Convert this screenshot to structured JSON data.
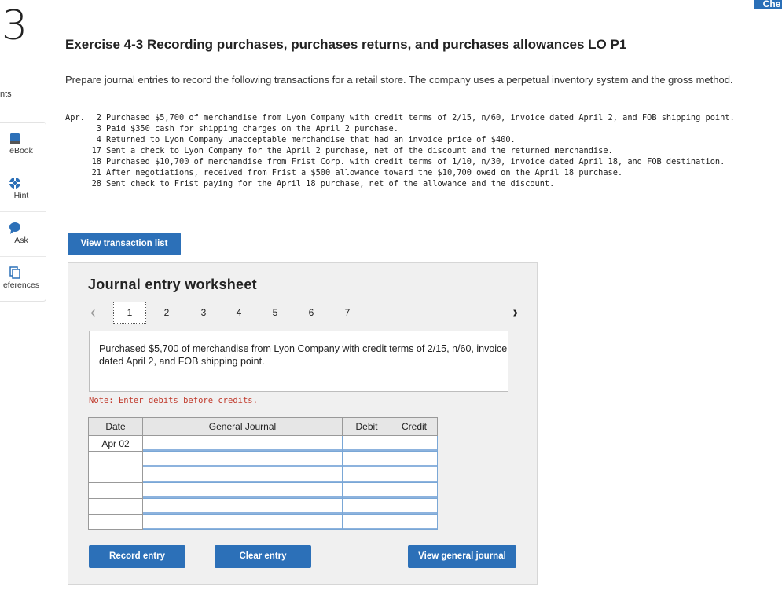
{
  "question_number": "3",
  "top_right_button": "Che",
  "cut_sidebar_label": "nts",
  "sidebar": [
    {
      "label": "eBook",
      "icon": "book-icon"
    },
    {
      "label": "Hint",
      "icon": "lifebuoy-icon"
    },
    {
      "label": "Ask",
      "icon": "speech-bubble-icon"
    },
    {
      "label": "eferences",
      "icon": "copy-icon"
    }
  ],
  "title": "Exercise 4-3 Recording purchases, purchases returns, and purchases allowances LO P1",
  "intro": "Prepare journal entries to record the following transactions for a retail store. The company uses a perpetual inventory system and the gross method.",
  "transactions": {
    "month": "Apr.",
    "items": [
      {
        "day": "2",
        "text": "Purchased $5,700 of merchandise from Lyon Company with credit terms of 2/15, n/60, invoice dated April 2, and FOB shipping point."
      },
      {
        "day": "3",
        "text": "Paid $350 cash for shipping charges on the April 2 purchase."
      },
      {
        "day": "4",
        "text": "Returned to Lyon Company unacceptable merchandise that had an invoice price of $400."
      },
      {
        "day": "17",
        "text": "Sent a check to Lyon Company for the April 2 purchase, net of the discount and the returned merchandise."
      },
      {
        "day": "18",
        "text": "Purchased $10,700 of merchandise from Frist Corp. with credit terms of 1/10, n/30, invoice dated April 18, and FOB destination."
      },
      {
        "day": "21",
        "text": "After negotiations, received from Frist a $500 allowance toward the $10,700 owed on the April 18 purchase."
      },
      {
        "day": "28",
        "text": "Sent check to Frist paying for the April 18 purchase, net of the allowance and the discount."
      }
    ]
  },
  "view_transaction_list": "View transaction list",
  "worksheet": {
    "title": "Journal entry worksheet",
    "pages": [
      "1",
      "2",
      "3",
      "4",
      "5",
      "6",
      "7"
    ],
    "active_page": "1",
    "description": "Purchased $5,700 of merchandise from Lyon Company with credit terms of 2/15, n/60, invoice dated April 2, and FOB shipping point.",
    "note": "Note: Enter debits before credits.",
    "columns": {
      "date": "Date",
      "journal": "General Journal",
      "debit": "Debit",
      "credit": "Credit"
    },
    "rows": [
      {
        "date": "Apr 02",
        "account": "",
        "debit": "",
        "credit": ""
      },
      {
        "date": "",
        "account": "",
        "debit": "",
        "credit": ""
      },
      {
        "date": "",
        "account": "",
        "debit": "",
        "credit": ""
      },
      {
        "date": "",
        "account": "",
        "debit": "",
        "credit": ""
      },
      {
        "date": "",
        "account": "",
        "debit": "",
        "credit": ""
      },
      {
        "date": "",
        "account": "",
        "debit": "",
        "credit": ""
      }
    ],
    "buttons": {
      "record": "Record entry",
      "clear": "Clear entry",
      "view_journal": "View general journal"
    }
  }
}
